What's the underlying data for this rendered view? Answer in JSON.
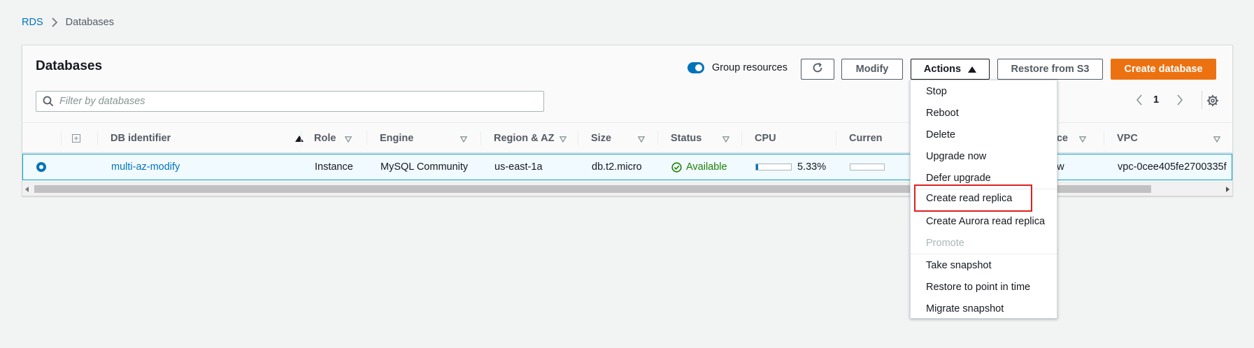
{
  "breadcrumb": {
    "root": "RDS",
    "current": "Databases"
  },
  "panel": {
    "title": "Databases"
  },
  "toolbar": {
    "group_resources_label": "Group resources",
    "group_resources_on": true,
    "modify_label": "Modify",
    "actions_label": "Actions",
    "restore_label": "Restore from S3",
    "create_label": "Create database"
  },
  "filter": {
    "placeholder": "Filter by databases",
    "value": ""
  },
  "pagination": {
    "page": "1"
  },
  "table": {
    "columns": [
      "DB identifier",
      "Role",
      "Engine",
      "Region & AZ",
      "Size",
      "Status",
      "CPU",
      "Curren",
      "nce",
      "VPC"
    ],
    "row": {
      "db_identifier": "multi-az-modify",
      "role": "Instance",
      "engine": "MySQL Community",
      "region_az": "us-east-1a",
      "size": "db.t2.micro",
      "status": "Available",
      "cpu": "5.33%",
      "cpu_fraction": 0.0533,
      "maintenance_partial": "ow",
      "vpc": "vpc-0cee405fe2700335f"
    }
  },
  "actions_menu": {
    "items": [
      {
        "label": "Stop",
        "disabled": false
      },
      {
        "label": "Reboot",
        "disabled": false
      },
      {
        "label": "Delete",
        "disabled": false
      },
      {
        "label": "Upgrade now",
        "disabled": false
      },
      {
        "label": "Defer upgrade",
        "disabled": false
      },
      {
        "label": "Create read replica",
        "disabled": false,
        "highlighted": true
      },
      {
        "label": "Create Aurora read replica",
        "disabled": false
      },
      {
        "label": "Promote",
        "disabled": true
      },
      {
        "label": "Take snapshot",
        "disabled": false
      },
      {
        "label": "Restore to point in time",
        "disabled": false
      },
      {
        "label": "Migrate snapshot",
        "disabled": false
      }
    ]
  },
  "colors": {
    "accent": "#0073bb",
    "primary_button": "#ec7211",
    "status_available": "#1d8102",
    "highlight_box": "#e02020"
  }
}
